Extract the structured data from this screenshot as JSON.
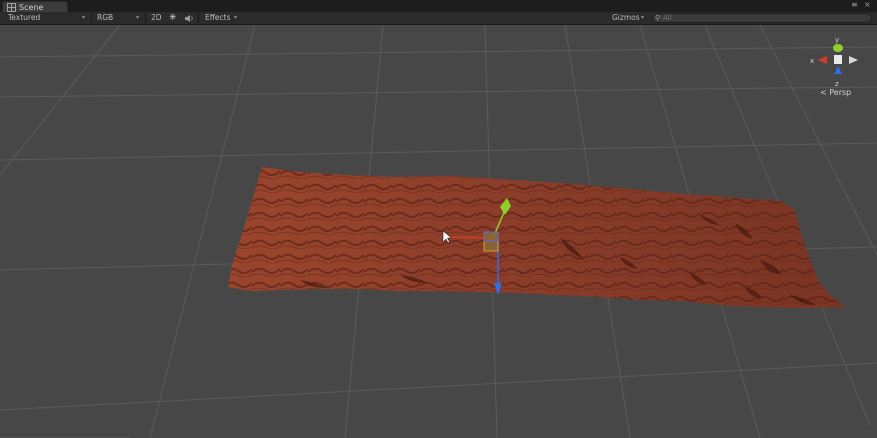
{
  "window": {
    "tab_label": "Scene",
    "controls": [
      "≡",
      "×"
    ]
  },
  "toolbar": {
    "render_mode": "Textured",
    "color_mode": "RGB",
    "mode_2d": "2D",
    "lighting_icon": "sun-icon",
    "audio_icon": "speaker-icon",
    "effects_label": "Effects",
    "gizmos_label": "Gizmos",
    "search_placeholder": "All"
  },
  "scene_gizmo": {
    "axis_y": "y",
    "axis_x": "x",
    "axis_z": "z",
    "projection_label": "Persp"
  },
  "colors": {
    "grid_background": "#474747",
    "grid_line": "#5a5a5a",
    "terrain": "#8a3e2a",
    "axis_x": "#d43a25",
    "axis_y": "#8fd12a",
    "axis_z": "#2f6fe8"
  }
}
